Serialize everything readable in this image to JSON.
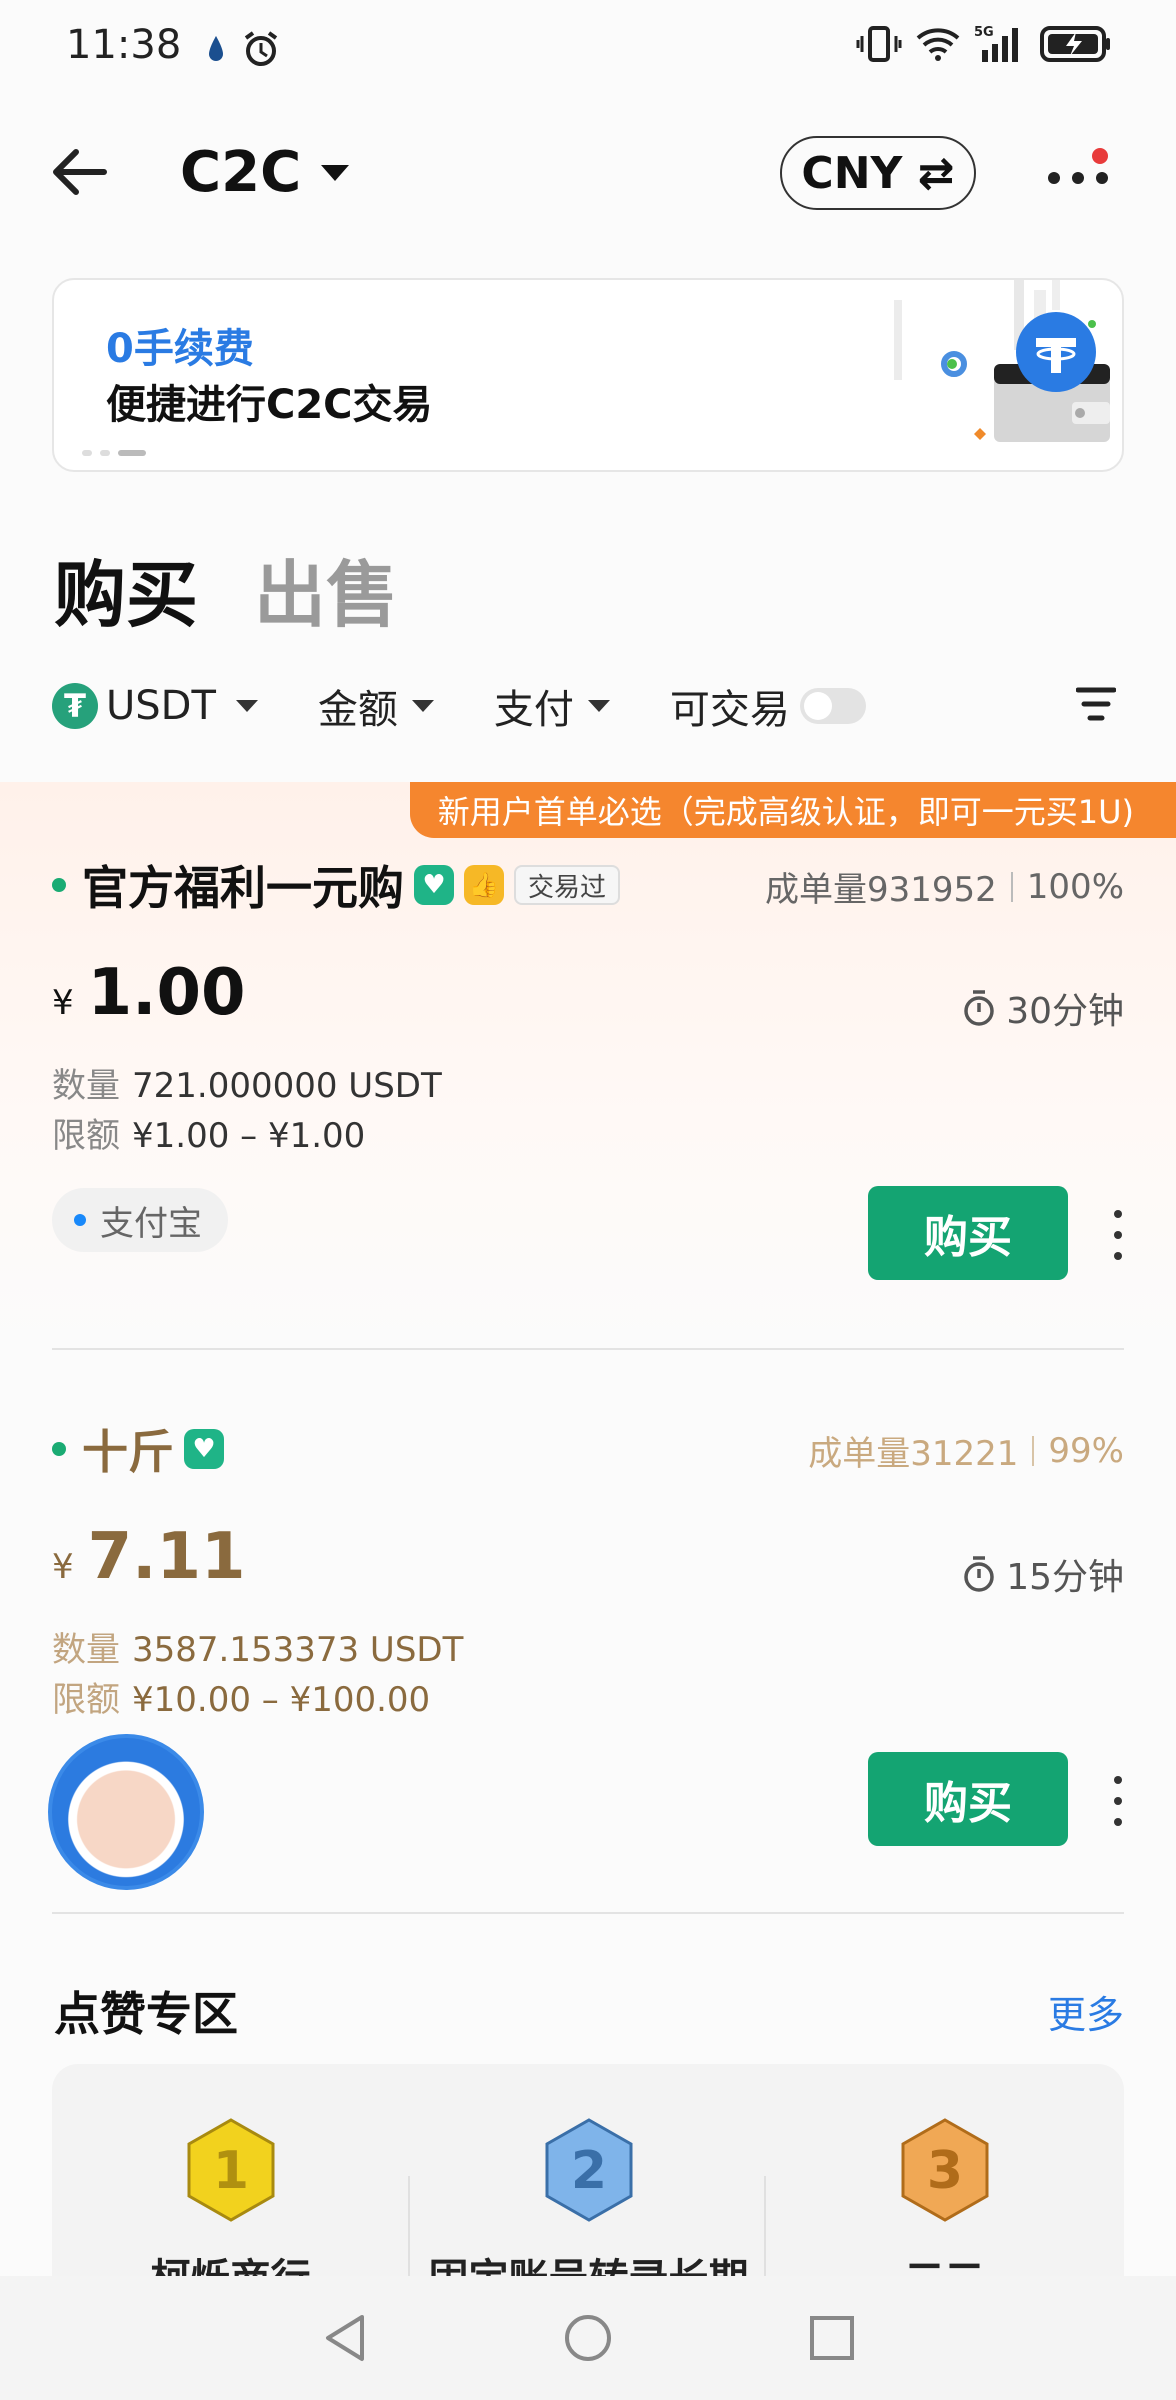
{
  "status_bar": {
    "time": "11:38",
    "icons": [
      "water-drop-icon",
      "alarm-icon",
      "vibrate-icon",
      "wifi-icon",
      "signal-5g-icon",
      "battery-charging-icon"
    ]
  },
  "header": {
    "title": "C2C",
    "currency_button": "CNY ⇄",
    "has_notification_dot": true
  },
  "banner": {
    "line1": "0手续费",
    "line2": "便捷进行C2C交易"
  },
  "tabs": [
    {
      "label": "购买",
      "active": true
    },
    {
      "label": "出售",
      "active": false
    }
  ],
  "filters": {
    "coin": "USDT",
    "amount": "金额",
    "payment": "支付",
    "tradable": "可交易",
    "tradable_on": false
  },
  "listings": [
    {
      "promo": "新用户首单必选（完成高级认证，即可一元买1U)",
      "merchant": "官方福利一元购",
      "traded_badge": "交易过",
      "orders": "成单量931952",
      "completion": "100%",
      "currency_symbol": "¥",
      "price": "1.00",
      "time_limit": "30分钟",
      "quantity_label": "数量",
      "quantity": "721.000000 USDT",
      "limit_label": "限额",
      "limit": "¥1.00 – ¥1.00",
      "payment": "支付宝",
      "buy_label": "购买"
    },
    {
      "merchant": "十斤",
      "orders": "成单量31221",
      "completion": "99%",
      "currency_symbol": "¥",
      "price": "7.11",
      "time_limit": "15分钟",
      "quantity_label": "数量",
      "quantity": "3587.153373 USDT",
      "limit_label": "限额",
      "limit": "¥10.00 – ¥100.00",
      "buy_label": "购买"
    }
  ],
  "likes_zone": {
    "title": "点赞专区",
    "more": "更多",
    "ranks": [
      {
        "rank": "1",
        "name": "柯烁商行",
        "color": "#f2d21e"
      },
      {
        "rank": "2",
        "name": "固定账号转录长期",
        "color": "#7fb4ea"
      },
      {
        "rank": "3",
        "name": "二二",
        "color": "#f0a855"
      }
    ]
  }
}
